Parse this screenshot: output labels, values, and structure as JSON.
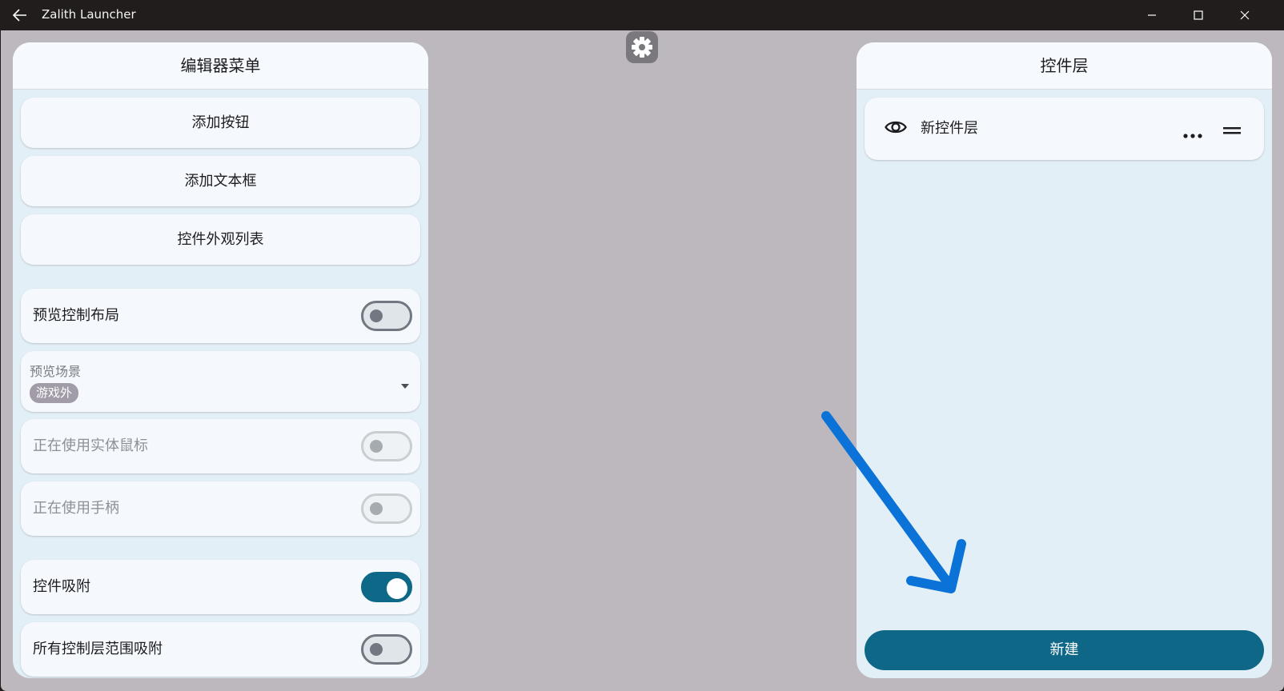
{
  "window": {
    "title": "Zalith Launcher",
    "back_icon": "back-arrow-icon",
    "controls": [
      "minimize-icon",
      "maximize-icon",
      "close-icon"
    ]
  },
  "settings_button": {
    "icon": "gear-icon"
  },
  "editor_menu": {
    "title": "编辑器菜单",
    "add_button_label": "添加按钮",
    "add_textbox_label": "添加文本框",
    "widget_styles_label": "控件外观列表",
    "preview_layout": {
      "label": "预览控制布局",
      "checked": false,
      "enabled": true
    },
    "preview_scene": {
      "label": "预览场景",
      "value": "游戏外"
    },
    "physical_mouse": {
      "label": "正在使用实体鼠标",
      "checked": false,
      "enabled": false
    },
    "gamepad": {
      "label": "正在使用手柄",
      "checked": false,
      "enabled": false
    },
    "widget_snap": {
      "label": "控件吸附",
      "checked": true,
      "enabled": true
    },
    "all_layers_snap": {
      "label": "所有控制层范围吸附",
      "checked": false,
      "enabled": true
    }
  },
  "layers_panel": {
    "title": "控件层",
    "layers": [
      {
        "name": "新控件层",
        "visible": true,
        "icons": [
          "eye-icon",
          "more-horizontal-icon",
          "drag-handle-icon"
        ]
      }
    ],
    "create_label": "新建"
  },
  "colors": {
    "accent": "#0f6788",
    "canvas": "#bcb8be",
    "panel": "#e3eff6",
    "card": "#f5f8fc",
    "annotation_arrow": "#0b72d8"
  }
}
